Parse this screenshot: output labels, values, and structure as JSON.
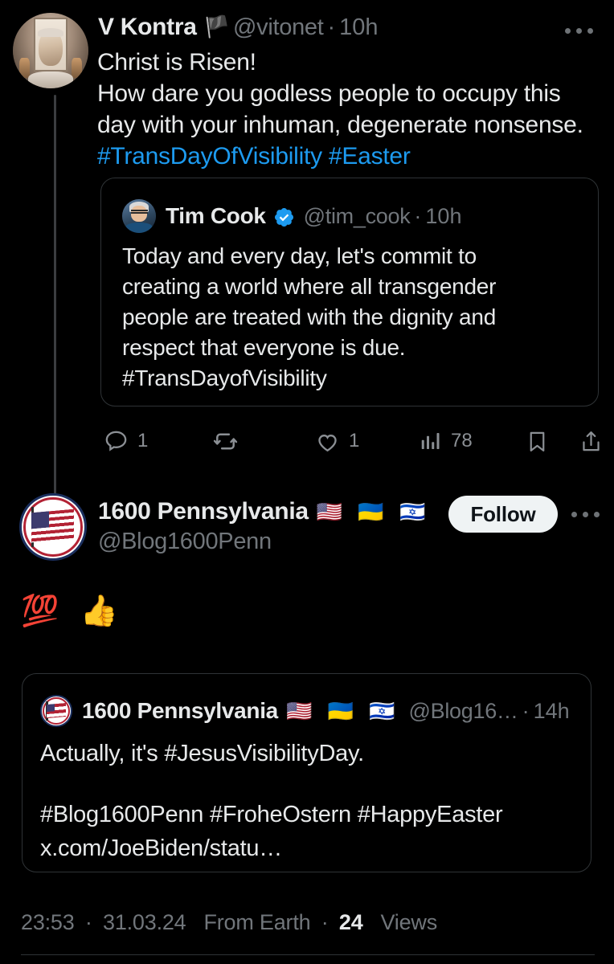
{
  "theme": {
    "background": "#000000",
    "text_primary": "#e7e9ea",
    "text_secondary": "#71767b",
    "accent_link": "#1d9bf0",
    "border": "#2f3336",
    "follow_button_bg": "#eff3f4"
  },
  "tweet_main": {
    "author": {
      "display_name": "V Kontra",
      "name_emoji": "🏴",
      "handle": "@vitonet",
      "separator": "·",
      "timestamp": "10h",
      "avatar_alt": "classical marble bust photo"
    },
    "more_menu_label": "More",
    "body": {
      "line1": "Christ is Risen!",
      "line2": "How dare you godless people to occupy this",
      "line3": "day with your inhuman, degenerate nonsense.",
      "hashtag1": "#TransDayOfVisibility",
      "hashtag2": "#Easter"
    },
    "quoted_tweet": {
      "author": {
        "display_name": "Tim Cook",
        "verified": true,
        "handle": "@tim_cook",
        "separator": "·",
        "timestamp": "10h",
        "avatar_alt": "Tim Cook headshot"
      },
      "body": {
        "line1": "Today and every day, let's commit to",
        "line2": "creating a world where all transgender",
        "line3": "people are treated with the dignity and",
        "line4": "respect that everyone is due.",
        "line5": "#TransDayofVisibility"
      }
    },
    "actions": {
      "reply": {
        "icon": "reply-icon",
        "count": "1"
      },
      "retweet": {
        "icon": "retweet-icon",
        "count": ""
      },
      "like": {
        "icon": "heart-icon",
        "count": "1"
      },
      "views": {
        "icon": "analytics-icon",
        "count": "78"
      },
      "bookmark": {
        "icon": "bookmark-icon",
        "count": ""
      },
      "share": {
        "icon": "share-icon",
        "count": ""
      }
    }
  },
  "tweet_reply": {
    "author": {
      "display_name": "1600 Pennsylvania",
      "flags": "🇺🇸 🇺🇦 🇮🇱",
      "handle": "@Blog1600Penn",
      "avatar_alt": "US flag circular badge"
    },
    "follow_button_label": "Follow",
    "more_menu_label": "More",
    "body_emoji": "💯 👍",
    "quoted_tweet": {
      "author": {
        "display_name": "1600 Pennsylvania",
        "flags": "🇺🇸 🇺🇦 🇮🇱",
        "handle": "@Blog16…",
        "separator": "·",
        "timestamp": "14h",
        "avatar_alt": "US flag circular badge"
      },
      "body": {
        "line1": "Actually, it's #JesusVisibilityDay.",
        "line2": "#Blog1600Penn #FroheOstern #HappyEaster",
        "line3": "x.com/JoeBiden/statu…"
      }
    }
  },
  "footer": {
    "time": "23:53",
    "sep1": "·",
    "date": "31.03.24",
    "source": "From Earth",
    "sep2": "·",
    "views_count": "24",
    "views_label": "Views"
  }
}
